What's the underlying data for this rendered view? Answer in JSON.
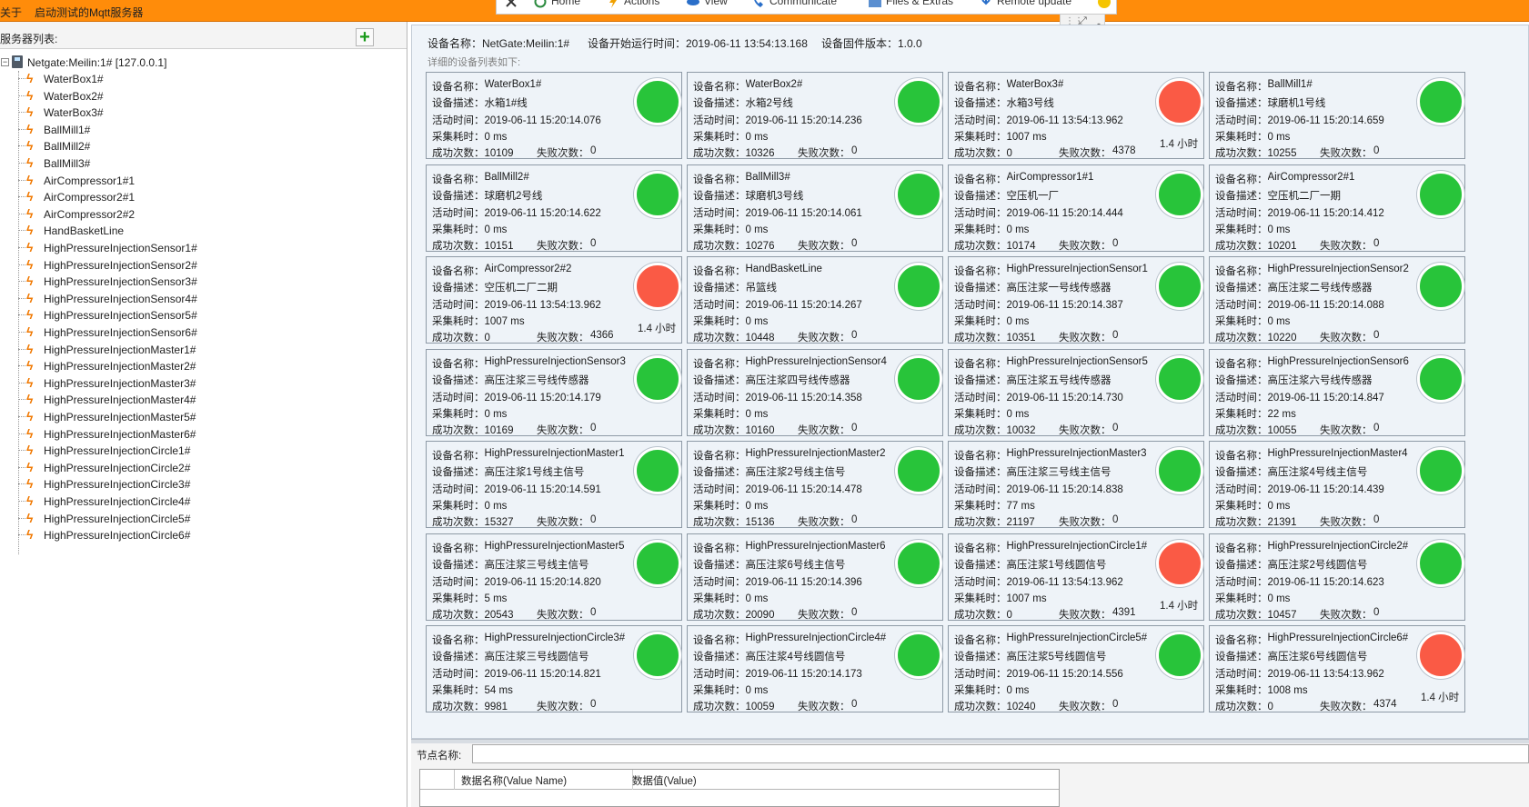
{
  "menubar": {
    "items": [
      "关于",
      "启动测试的Mqtt服务器"
    ]
  },
  "ribbon": {
    "items": [
      {
        "label": "",
        "icon": "close-icon"
      },
      {
        "label": "Home",
        "icon": "refresh-icon"
      },
      {
        "label": "Actions",
        "icon": "bolt-icon"
      },
      {
        "label": "View",
        "icon": "eye-icon"
      },
      {
        "label": "Communicate",
        "icon": "phone-icon"
      },
      {
        "label": "Files & Extras",
        "icon": "folder-icon"
      },
      {
        "label": "Remote update",
        "icon": "download-icon"
      }
    ]
  },
  "left": {
    "header": "服务器列表:",
    "root": "Netgate:Meilin:1# [127.0.0.1]",
    "nodes": [
      "WaterBox1#",
      "WaterBox2#",
      "WaterBox3#",
      "BallMill1#",
      "BallMill2#",
      "BallMill3#",
      "AirCompressor1#1",
      "AirCompressor2#1",
      "AirCompressor2#2",
      "HandBasketLine",
      "HighPressureInjectionSensor1#",
      "HighPressureInjectionSensor2#",
      "HighPressureInjectionSensor3#",
      "HighPressureInjectionSensor4#",
      "HighPressureInjectionSensor5#",
      "HighPressureInjectionSensor6#",
      "HighPressureInjectionMaster1#",
      "HighPressureInjectionMaster2#",
      "HighPressureInjectionMaster3#",
      "HighPressureInjectionMaster4#",
      "HighPressureInjectionMaster5#",
      "HighPressureInjectionMaster6#",
      "HighPressureInjectionCircle1#",
      "HighPressureInjectionCircle2#",
      "HighPressureInjectionCircle3#",
      "HighPressureInjectionCircle4#",
      "HighPressureInjectionCircle5#",
      "HighPressureInjectionCircle6#"
    ]
  },
  "header": {
    "device_name": "设备名称：NetGate:Meilin:1#",
    "start_time": "设备开始运行时间：2019-06-11 13:54:13.168",
    "firmware": "设备固件版本：1.0.0",
    "subtitle": "详细的设备列表如下:"
  },
  "labels": {
    "name": "设备名称：",
    "desc": "设备描述：",
    "active": "活动时间：",
    "cost": "采集耗时：",
    "success": "成功次数：",
    "fail": "失败次数："
  },
  "colors": {
    "ok": "#28c43a",
    "bad": "#fa5a45",
    "menubar": "#ff8c0a"
  },
  "cards": [
    {
      "name": "WaterBox1#",
      "desc": "水箱1#线",
      "time": "2019-06-11 15:20:14.076",
      "cost": "0 ms",
      "success": "10109",
      "fail": "0",
      "status": "ok",
      "duration": ""
    },
    {
      "name": "WaterBox2#",
      "desc": "水箱2号线",
      "time": "2019-06-11 15:20:14.236",
      "cost": "0 ms",
      "success": "10326",
      "fail": "0",
      "status": "ok",
      "duration": ""
    },
    {
      "name": "WaterBox3#",
      "desc": "水箱3号线",
      "time": "2019-06-11 13:54:13.962",
      "cost": "1007 ms",
      "success": "0",
      "fail": "4378",
      "status": "bad",
      "duration": "1.4 小时"
    },
    {
      "name": "BallMill1#",
      "desc": "球磨机1号线",
      "time": "2019-06-11 15:20:14.659",
      "cost": "0 ms",
      "success": "10255",
      "fail": "0",
      "status": "ok",
      "duration": ""
    },
    {
      "name": "BallMill2#",
      "desc": "球磨机2号线",
      "time": "2019-06-11 15:20:14.622",
      "cost": "0 ms",
      "success": "10151",
      "fail": "0",
      "status": "ok",
      "duration": ""
    },
    {
      "name": "BallMill3#",
      "desc": "球磨机3号线",
      "time": "2019-06-11 15:20:14.061",
      "cost": "0 ms",
      "success": "10276",
      "fail": "0",
      "status": "ok",
      "duration": ""
    },
    {
      "name": "AirCompressor1#1",
      "desc": "空压机一厂",
      "time": "2019-06-11 15:20:14.444",
      "cost": "0 ms",
      "success": "10174",
      "fail": "0",
      "status": "ok",
      "duration": ""
    },
    {
      "name": "AirCompressor2#1",
      "desc": "空压机二厂一期",
      "time": "2019-06-11 15:20:14.412",
      "cost": "0 ms",
      "success": "10201",
      "fail": "0",
      "status": "ok",
      "duration": ""
    },
    {
      "name": "AirCompressor2#2",
      "desc": "空压机二厂二期",
      "time": "2019-06-11 13:54:13.962",
      "cost": "1007 ms",
      "success": "0",
      "fail": "4366",
      "status": "bad",
      "duration": "1.4 小时"
    },
    {
      "name": "HandBasketLine",
      "desc": "吊篮线",
      "time": "2019-06-11 15:20:14.267",
      "cost": "0 ms",
      "success": "10448",
      "fail": "0",
      "status": "ok",
      "duration": ""
    },
    {
      "name": "HighPressureInjectionSensor1",
      "desc": "高压注浆一号线传感器",
      "time": "2019-06-11 15:20:14.387",
      "cost": "0 ms",
      "success": "10351",
      "fail": "0",
      "status": "ok",
      "duration": ""
    },
    {
      "name": "HighPressureInjectionSensor2",
      "desc": "高压注浆二号线传感器",
      "time": "2019-06-11 15:20:14.088",
      "cost": "0 ms",
      "success": "10220",
      "fail": "0",
      "status": "ok",
      "duration": ""
    },
    {
      "name": "HighPressureInjectionSensor3",
      "desc": "高压注浆三号线传感器",
      "time": "2019-06-11 15:20:14.179",
      "cost": "0 ms",
      "success": "10169",
      "fail": "0",
      "status": "ok",
      "duration": ""
    },
    {
      "name": "HighPressureInjectionSensor4",
      "desc": "高压注浆四号线传感器",
      "time": "2019-06-11 15:20:14.358",
      "cost": "0 ms",
      "success": "10160",
      "fail": "0",
      "status": "ok",
      "duration": ""
    },
    {
      "name": "HighPressureInjectionSensor5",
      "desc": "高压注浆五号线传感器",
      "time": "2019-06-11 15:20:14.730",
      "cost": "0 ms",
      "success": "10032",
      "fail": "0",
      "status": "ok",
      "duration": ""
    },
    {
      "name": "HighPressureInjectionSensor6",
      "desc": "高压注浆六号线传感器",
      "time": "2019-06-11 15:20:14.847",
      "cost": "22 ms",
      "success": "10055",
      "fail": "0",
      "status": "ok",
      "duration": ""
    },
    {
      "name": "HighPressureInjectionMaster1",
      "desc": "高压注浆1号线主信号",
      "time": "2019-06-11 15:20:14.591",
      "cost": "0 ms",
      "success": "15327",
      "fail": "0",
      "status": "ok",
      "duration": ""
    },
    {
      "name": "HighPressureInjectionMaster2",
      "desc": "高压注浆2号线主信号",
      "time": "2019-06-11 15:20:14.478",
      "cost": "0 ms",
      "success": "15136",
      "fail": "0",
      "status": "ok",
      "duration": ""
    },
    {
      "name": "HighPressureInjectionMaster3",
      "desc": "高压注浆三号线主信号",
      "time": "2019-06-11 15:20:14.838",
      "cost": "77 ms",
      "success": "21197",
      "fail": "0",
      "status": "ok",
      "duration": ""
    },
    {
      "name": "HighPressureInjectionMaster4",
      "desc": "高压注浆4号线主信号",
      "time": "2019-06-11 15:20:14.439",
      "cost": "0 ms",
      "success": "21391",
      "fail": "0",
      "status": "ok",
      "duration": ""
    },
    {
      "name": "HighPressureInjectionMaster5",
      "desc": "高压注浆三号线主信号",
      "time": "2019-06-11 15:20:14.820",
      "cost": "5 ms",
      "success": "20543",
      "fail": "0",
      "status": "ok",
      "duration": ""
    },
    {
      "name": "HighPressureInjectionMaster6",
      "desc": "高压注浆6号线主信号",
      "time": "2019-06-11 15:20:14.396",
      "cost": "0 ms",
      "success": "20090",
      "fail": "0",
      "status": "ok",
      "duration": ""
    },
    {
      "name": "HighPressureInjectionCircle1#",
      "desc": "高压注浆1号线圆信号",
      "time": "2019-06-11 13:54:13.962",
      "cost": "1007 ms",
      "success": "0",
      "fail": "4391",
      "status": "bad",
      "duration": "1.4 小时"
    },
    {
      "name": "HighPressureInjectionCircle2#",
      "desc": "高压注浆2号线圆信号",
      "time": "2019-06-11 15:20:14.623",
      "cost": "0 ms",
      "success": "10457",
      "fail": "0",
      "status": "ok",
      "duration": ""
    },
    {
      "name": "HighPressureInjectionCircle3#",
      "desc": "高压注浆三号线圆信号",
      "time": "2019-06-11 15:20:14.821",
      "cost": "54 ms",
      "success": "9981",
      "fail": "0",
      "status": "ok",
      "duration": ""
    },
    {
      "name": "HighPressureInjectionCircle4#",
      "desc": "高压注浆4号线圆信号",
      "time": "2019-06-11 15:20:14.173",
      "cost": "0 ms",
      "success": "10059",
      "fail": "0",
      "status": "ok",
      "duration": ""
    },
    {
      "name": "HighPressureInjectionCircle5#",
      "desc": "高压注浆5号线圆信号",
      "time": "2019-06-11 15:20:14.556",
      "cost": "0 ms",
      "success": "10240",
      "fail": "0",
      "status": "ok",
      "duration": ""
    },
    {
      "name": "HighPressureInjectionCircle6#",
      "desc": "高压注浆6号线圆信号",
      "time": "2019-06-11 13:54:13.962",
      "cost": "1008 ms",
      "success": "0",
      "fail": "4374",
      "status": "bad",
      "duration": "1.4 小时"
    }
  ],
  "bottom": {
    "node_name_label": "节点名称:",
    "node_name_value": "",
    "columns": [
      "数据名称(Value Name)",
      "数据值(Value)"
    ]
  }
}
